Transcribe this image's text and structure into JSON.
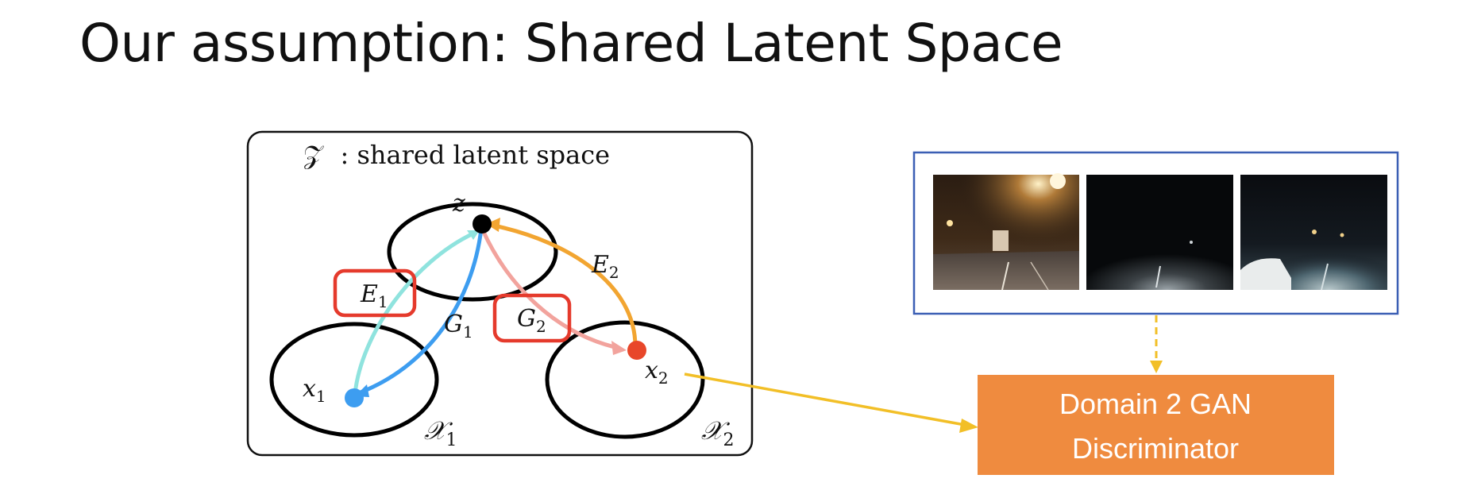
{
  "slide": {
    "title": "Our assumption: Shared Latent Space"
  },
  "latent_diagram": {
    "space_label_symbol": "𝒵",
    "space_label_text": ": shared latent space",
    "z_label": "z",
    "x1_label": "x",
    "x1_sub": "1",
    "x2_label": "x",
    "x2_sub": "2",
    "domain1_label": "𝒳",
    "domain1_sub": "1",
    "domain2_label": "𝒳",
    "domain2_sub": "2",
    "E1_label": "E",
    "E1_sub": "1",
    "E2_label": "E",
    "E2_sub": "2",
    "G1_label": "G",
    "G1_sub": "1",
    "G2_label": "G",
    "G2_sub": "2",
    "colors": {
      "z_point": "#000000",
      "x1_point": "#3d9df0",
      "x2_point": "#e8472a",
      "E1_arrow": "#8fe3de",
      "G1_arrow": "#3d9df0",
      "G2_arrow": "#f2a39d",
      "E2_arrow": "#f2a531",
      "highlight_box": "#e53a2c"
    }
  },
  "photo_panel": {
    "images": [
      "night-road-photo-1",
      "night-road-photo-2",
      "night-road-photo-3"
    ],
    "border_color": "#3b5fb4"
  },
  "discriminator": {
    "line1": "Domain 2 GAN",
    "line2": "Discriminator",
    "fill_color": "#ef8b3f",
    "arrow_color": "#f2bf27"
  }
}
